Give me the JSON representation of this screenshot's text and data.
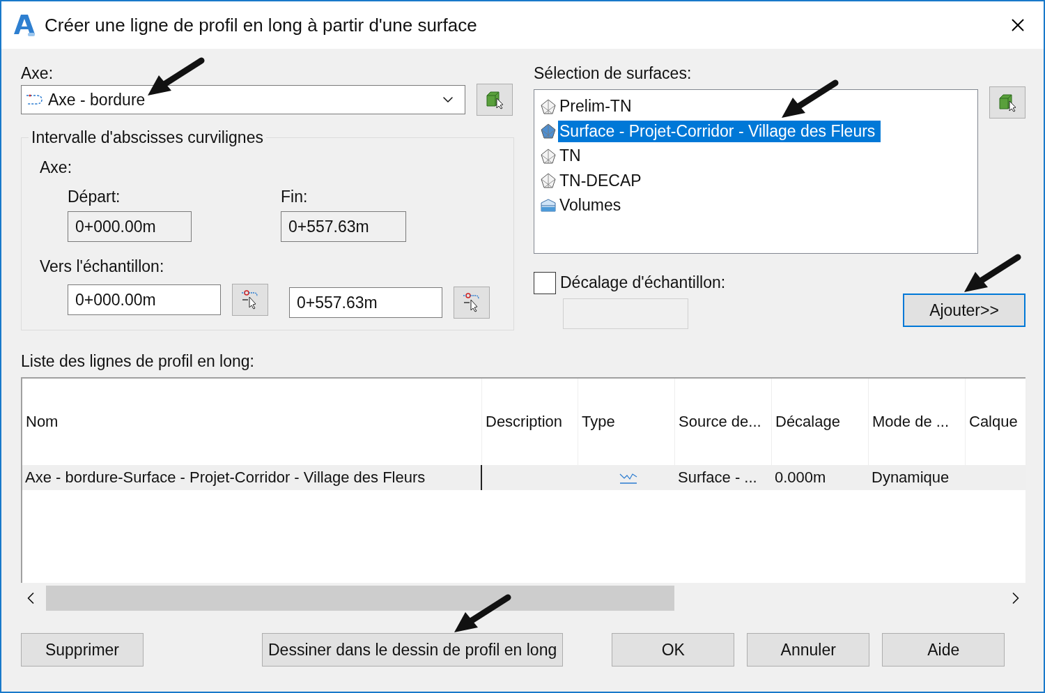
{
  "window": {
    "title": "Créer une ligne de profil en long à partir d'une surface"
  },
  "axis": {
    "label": "Axe:",
    "value": "Axe - bordure"
  },
  "station_range": {
    "title": "Intervalle d'abscisses curvilignes",
    "axis_label": "Axe:",
    "start_label": "Départ:",
    "start_value": "0+000.00m",
    "end_label": "Fin:",
    "end_value": "0+557.63m",
    "sample_label": "Vers l'échantillon:",
    "sample_start": "0+000.00m",
    "sample_end": "0+557.63m"
  },
  "surfaces": {
    "label": "Sélection de surfaces:",
    "items": [
      {
        "name": "Prelim-TN",
        "kind": "tin",
        "selected": false
      },
      {
        "name": "Surface - Projet-Corridor - Village des Fleurs",
        "kind": "tin",
        "selected": true
      },
      {
        "name": "TN",
        "kind": "tin",
        "selected": false
      },
      {
        "name": "TN-DECAP",
        "kind": "tin",
        "selected": false
      },
      {
        "name": "Volumes",
        "kind": "volume",
        "selected": false
      }
    ]
  },
  "sample_offset": {
    "label": "Décalage d'échantillon:",
    "checked": false
  },
  "add_button": {
    "label": "Ajouter>>",
    "focused": true
  },
  "profile_list": {
    "label": "Liste des lignes de profil en long:",
    "columns": [
      "Nom",
      "Description",
      "Type",
      "Source de...",
      "Décalage",
      "Mode de ...",
      "Calque"
    ],
    "rows": [
      {
        "name": "Axe - bordure-Surface - Projet-Corridor - Village des Fleurs",
        "source": "Surface - ...",
        "offset": "0.000m",
        "mode": "Dynamique",
        "selected": true
      }
    ]
  },
  "buttons": [
    "Supprimer",
    "Dessiner dans le dessin de profil en long",
    "OK",
    "Annuler",
    "Aide"
  ]
}
